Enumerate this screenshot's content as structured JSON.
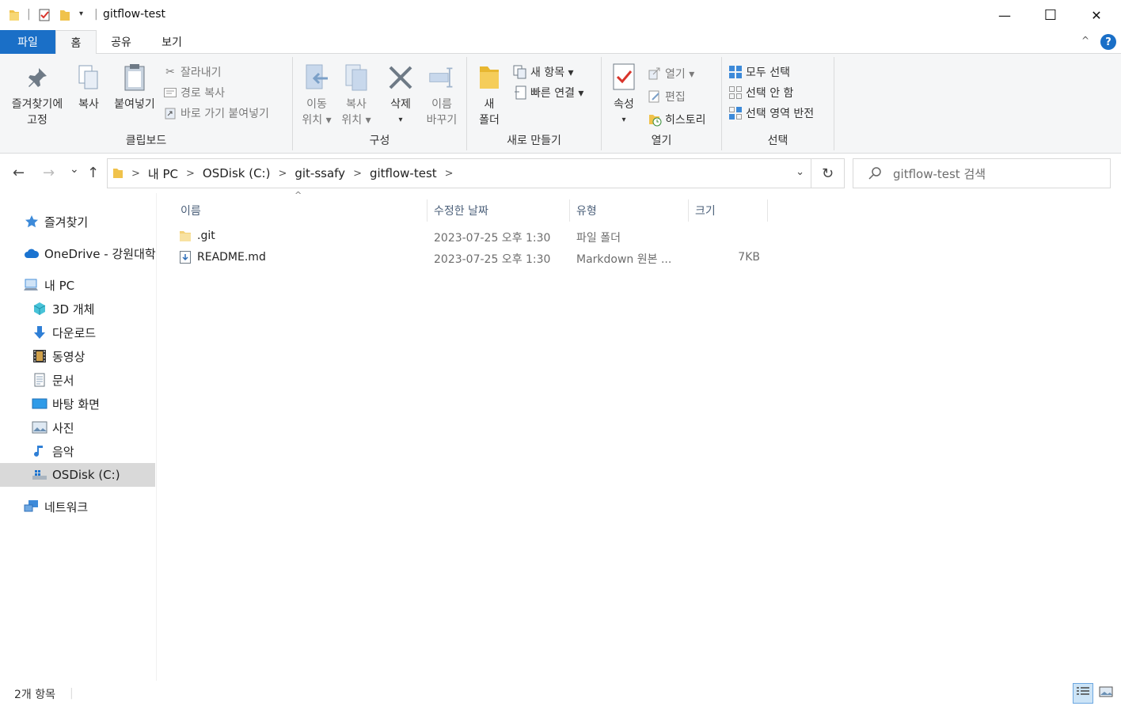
{
  "window": {
    "title": "gitflow-test",
    "minimize": "—",
    "maximize": "☐",
    "close": "✕"
  },
  "tabs": {
    "file": "파일",
    "home": "홈",
    "share": "공유",
    "view": "보기",
    "collapse": "^",
    "help": "?"
  },
  "ribbon": {
    "clipboard": {
      "label": "클립보드",
      "pin_line1": "즐겨찾기에",
      "pin_line2": "고정",
      "copy": "복사",
      "paste": "붙여넣기",
      "cut": "잘라내기",
      "copy_path": "경로 복사",
      "paste_shortcut": "바로 가기 붙여넣기"
    },
    "organize": {
      "label": "구성",
      "move_line1": "이동",
      "move_line2": "위치 ▾",
      "copyto_line1": "복사",
      "copyto_line2": "위치 ▾",
      "delete_line1": "삭제",
      "delete_line2": "▾",
      "rename_line1": "이름",
      "rename_line2": "바꾸기"
    },
    "new": {
      "label": "새로 만들기",
      "folder_line1": "새",
      "folder_line2": "폴더",
      "new_item": "새 항목 ▾",
      "easy_access": "빠른 연결 ▾"
    },
    "open": {
      "label": "열기",
      "props_line1": "속성",
      "props_line2": "▾",
      "open": "열기 ▾",
      "edit": "편집",
      "history": "히스토리"
    },
    "select": {
      "label": "선택",
      "all": "모두 선택",
      "none": "선택 안 함",
      "invert": "선택 영역 반전"
    }
  },
  "address": {
    "back": "←",
    "forward": "→",
    "recent": "⌄",
    "up": "↑",
    "crumbs": [
      "내 PC",
      "OSDisk (C:)",
      "git-ssafy",
      "gitflow-test"
    ],
    "sep": ">",
    "dropdown": "⌄",
    "refresh": "↻",
    "search_placeholder": "gitflow-test 검색"
  },
  "nav": {
    "favorites": "즐겨찾기",
    "onedrive": "OneDrive - 강원대학",
    "thispc": "내 PC",
    "objects3d": "3D 개체",
    "downloads": "다운로드",
    "videos": "동영상",
    "documents": "문서",
    "desktop": "바탕 화면",
    "pictures": "사진",
    "music": "음악",
    "osdisk": "OSDisk (C:)",
    "network": "네트워크"
  },
  "columns": {
    "name": "이름",
    "modified": "수정한 날짜",
    "type": "유형",
    "size": "크기",
    "sort_indicator": "^"
  },
  "files": [
    {
      "name": ".git",
      "modified": "2023-07-25 오후 1:30",
      "type": "파일 폴더",
      "size": ""
    },
    {
      "name": "README.md",
      "modified": "2023-07-25 오후 1:30",
      "type": "Markdown 원본 ...",
      "size": "7KB"
    }
  ],
  "status": {
    "count": "2개 항목"
  },
  "colors": {
    "accent": "#1a6fc7",
    "folder": "#f0c24b",
    "selected": "#d9d9d9"
  }
}
